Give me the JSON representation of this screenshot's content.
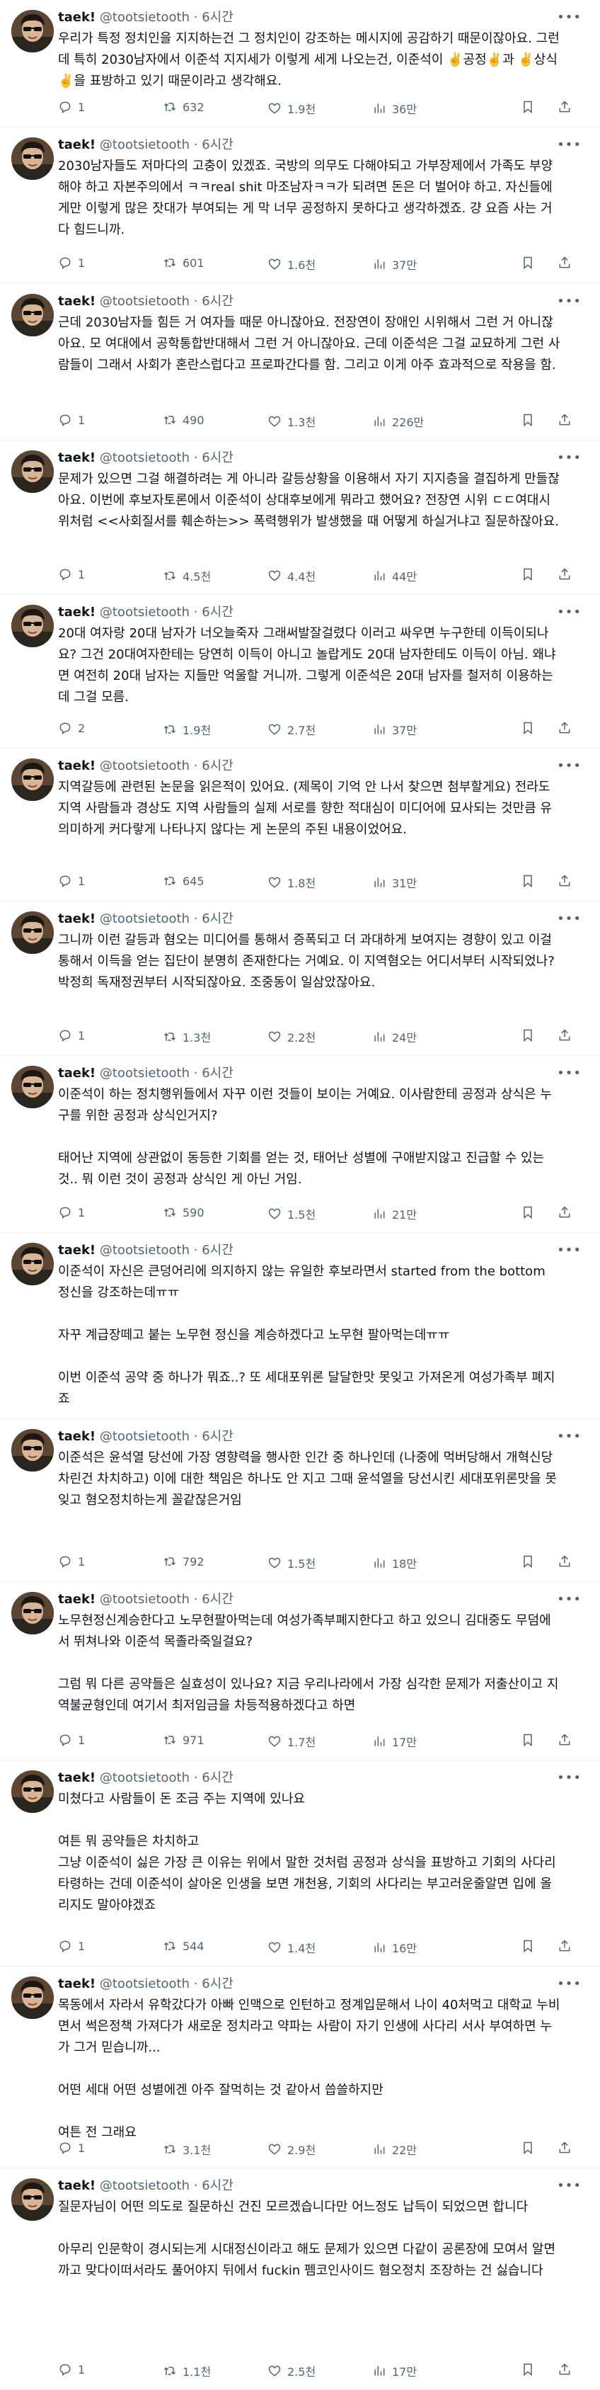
{
  "author": {
    "name": "taek!",
    "handle": "@tootsietooth",
    "time": "6시간",
    "dot": "·"
  },
  "icons": {
    "reply": "reply-icon",
    "retweet": "retweet-icon",
    "like": "like-icon",
    "views": "views-icon",
    "bookmark": "bookmark-icon",
    "share": "share-icon",
    "more": "more-icon"
  },
  "colors": {
    "text": "#0f1419",
    "secondary": "#536471",
    "divider": "#eff3f4"
  },
  "tweets": [
    {
      "paras": [
        "우리가 특정 정치인을 지지하는건 그 정치인이 강조하는 메시지에 공감하기 때문이잖아요. 그런데 특히 2030남자에서 이준석 지지세가 이렇게 세게 나오는건, 이준석이 ✌️공정✌️과 ✌️상식✌️을 표방하고 있기 때문이라고 생각해요."
      ],
      "reply": "1",
      "retweet": "632",
      "like": "1.9천",
      "views": "36만"
    },
    {
      "paras": [
        "2030남자들도 저마다의 고충이 있겠죠. 국방의 의무도 다해야되고 가부장제에서 가족도 부양해야 하고 자본주의에서 ㅋㅋreal shit 마조남자ㅋㅋ가 되려면 돈은 더 벌어야 하고. 자신들에게만 이렇게 많은 잣대가 부여되는 게 막 너무 공정하지 못하다고 생각하겠죠. 걍 요즘 사는 거 다 힘드니까."
      ],
      "reply": "1",
      "retweet": "601",
      "like": "1.6천",
      "views": "37만"
    },
    {
      "paras": [
        "근데 2030남자들 힘든 거 여자들 때문 아니잖아요. 전장연이 장애인 시위해서 그런 거 아니잖아요. 모 여대에서 공학통합반대해서 그런 거 아니잖아요. 근데 이준석은 그걸 교묘하게 그런 사람들이 그래서 사회가 혼란스럽다고 프로파간다를 함. 그리고 이게 아주 효과적으로 작용을 함."
      ],
      "reply": "1",
      "retweet": "490",
      "like": "1.3천",
      "views": "226만"
    },
    {
      "paras": [
        "문제가 있으면 그걸 해결하려는 게 아니라 갈등상황을 이용해서 자기 지지층을 결집하게 만들잖아요. 이번에 후보자토론에서 이준석이 상대후보에게 뭐라고 했어요? 전장연 시위 ㄷㄷ여대시위처럼 <<사회질서를 훼손하는>> 폭력행위가 발생했을 때 어떻게 하실거냐고 질문하잖아요."
      ],
      "reply": "1",
      "retweet": "4.5천",
      "like": "4.4천",
      "views": "44만"
    },
    {
      "paras": [
        "20대 여자랑 20대 남자가 너오늘죽자 그래써발잘걸렸다 이러고 싸우면 누구한테 이득이되나요? 그건 20대여자한테는 당연히 이득이 아니고 놀랍게도 20대 남자한테도 이득이 아님. 왜냐면 여전히 20대 남자는 지들만 억울할 거니까. 그렇게 이준석은 20대 남자를 철저히 이용하는데 그걸 모름."
      ],
      "reply": "2",
      "retweet": "1.9천",
      "like": "2.7천",
      "views": "37만"
    },
    {
      "paras": [
        "지역갈등에 관련된 논문을 읽은적이 있어요. (제목이 기억 안 나서 찾으면 첨부할게요) 전라도 지역 사람들과 경상도 지역 사람들의 실제 서로를 향한 적대심이 미디어에 묘사되는 것만큼 유의미하게 커다랗게 나타나지 않다는 게 논문의 주된 내용이었어요."
      ],
      "reply": "1",
      "retweet": "645",
      "like": "1.8천",
      "views": "31만"
    },
    {
      "paras": [
        "그니까 이런 갈등과 혐오는 미디어를 통해서 증폭되고 더 과대하게 보여지는 경향이 있고 이걸 통해서 이득을 얻는 집단이 분명히 존재한다는 거예요. 이 지역혐오는 어디서부터 시작되었나? 박정희 독재정권부터 시작되잖아요. 조중동이 일삼았잖아요."
      ],
      "reply": "1",
      "retweet": "1.3천",
      "like": "2.2천",
      "views": "24만"
    },
    {
      "paras": [
        "이준석이 하는 정치행위들에서 자꾸 이런 것들이 보이는 거예요. 이사람한테 공정과 상식은 누구를 위한 공정과 상식인거지?",
        "",
        "태어난 지역에 상관없이 동등한 기회를 얻는 것, 태어난 성별에 구애받지않고 진급할 수 있는 것.. 뭐 이런 것이 공정과 상식인 게 아닌 거임."
      ],
      "reply": "1",
      "retweet": "590",
      "like": "1.5천",
      "views": "21만"
    },
    {
      "paras": [
        "이준석이 자신은 큰덩어리에 의지하지 않는 유일한 후보라면서 started from the bottom 정신을 강조하는데ㅠㅠ",
        "",
        "자꾸 계급장떼고 붙는 노무현 정신을 계승하겠다고 노무현 팔아먹는데ㅠㅠ",
        "",
        "이번 이준석 공약 중 하나가 뭐죠..? 또 세대포위론 달달한맛 못잊고 가져온게 여성가족부 폐지죠"
      ],
      "reply": "",
      "retweet": "",
      "like": "",
      "views": ""
    },
    {
      "paras": [
        "이준석은 윤석열 당선에 가장 영향력을 행사한 인간 중 하나인데 (나중에 먹버당해서 개혁신당 차린건 차치하고) 이에 대한 책임은 하나도 안 지고 그때 윤석열을 당선시킨 세대포위론맛을 못잊고 혐오정치하는게 꼴같잖은거임"
      ],
      "reply": "1",
      "retweet": "792",
      "like": "1.5천",
      "views": "18만"
    },
    {
      "paras": [
        "노무현정신계승한다고 노무현팔아먹는데 여성가족부폐지한다고 하고 있으니 김대중도 무덤에서 뛰쳐나와 이준석 목졸라죽일걸요?",
        "",
        "그럼 뭐 다른 공약들은 실효성이 있나요? 지금 우리나라에서 가장 심각한 문제가 저출산이고 지역불균형인데 여기서 최저임금을 차등적용하겠다고 하면"
      ],
      "reply": "1",
      "retweet": "971",
      "like": "1.7천",
      "views": "17만"
    },
    {
      "paras": [
        "미쳤다고 사람들이 돈 조금 주는 지역에 있나요",
        "",
        "여튼 뭐 공약들은 차치하고",
        "그냥 이준석이 싫은 가장 큰 이유는 위에서 말한 것처럼 공정과 상식을 표방하고 기회의 사다리 타령하는 건데 이준석이 살아온 인생을 보면 개천용, 기회의 사다리는 부고러운줄알면 입에 올리지도 말아야겠죠"
      ],
      "reply": "1",
      "retweet": "544",
      "like": "1.4천",
      "views": "16만"
    },
    {
      "paras": [
        "목동에서 자라서 유학갔다가 아빠 인맥으로 인턴하고 정계입문해서 나이 40처먹고 대학교 누비면서 썩은정책 가져다가 새로운 정치라고 약파는 사람이 자기 인생에 사다리 서사 부여하면 누가 그거 믿습니까...",
        "",
        "어떤 세대 어떤 성별에겐 아주 잘먹히는 것 같아서 씁쓸하지만",
        "",
        "여튼 전 그래요"
      ],
      "reply": "1",
      "retweet": "3.1천",
      "like": "2.9천",
      "views": "22만"
    },
    {
      "paras": [
        "질문자님이 어떤 의도로 질문하신 건진 모르겠습니다만 어느정도 납득이 되었으면 합니다",
        "",
        "아무리 인문학이 경시되는게 시대정신이라고 해도 문제가 있으면 다같이 공론장에 모여서 알면까고 맞다이떠서라도 풀어야지 뒤에서 fuckin 펨코인사이드 혐오정치 조장하는 건 싫습니다"
      ],
      "reply": "1",
      "retweet": "1.1천",
      "like": "2.5천",
      "views": "17만"
    }
  ]
}
